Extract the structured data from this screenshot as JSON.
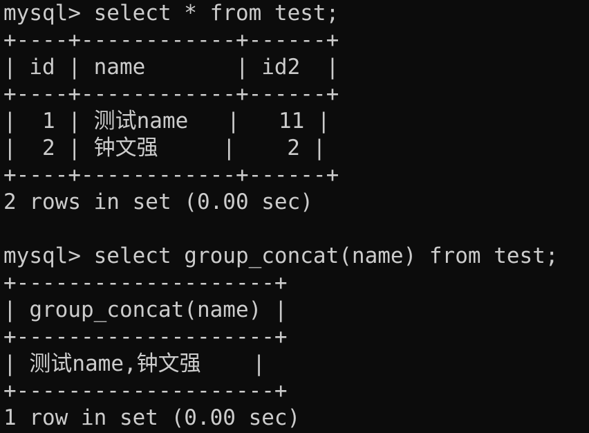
{
  "terminal": {
    "lines": [
      "mysql> select * from test;",
      "+----+------------+------+",
      "| id | name       | id2  |",
      "+----+------------+------+",
      "|  1 | 测试name   |   11 |",
      "|  2 | 钟文强     |    2 |",
      "+----+------------+------+",
      "2 rows in set (0.00 sec)",
      "",
      "mysql> select group_concat(name) from test;",
      "+--------------------+",
      "| group_concat(name) |",
      "+--------------------+",
      "| 测试name,钟文强    |",
      "+--------------------+",
      "1 row in set (0.00 sec)"
    ]
  }
}
